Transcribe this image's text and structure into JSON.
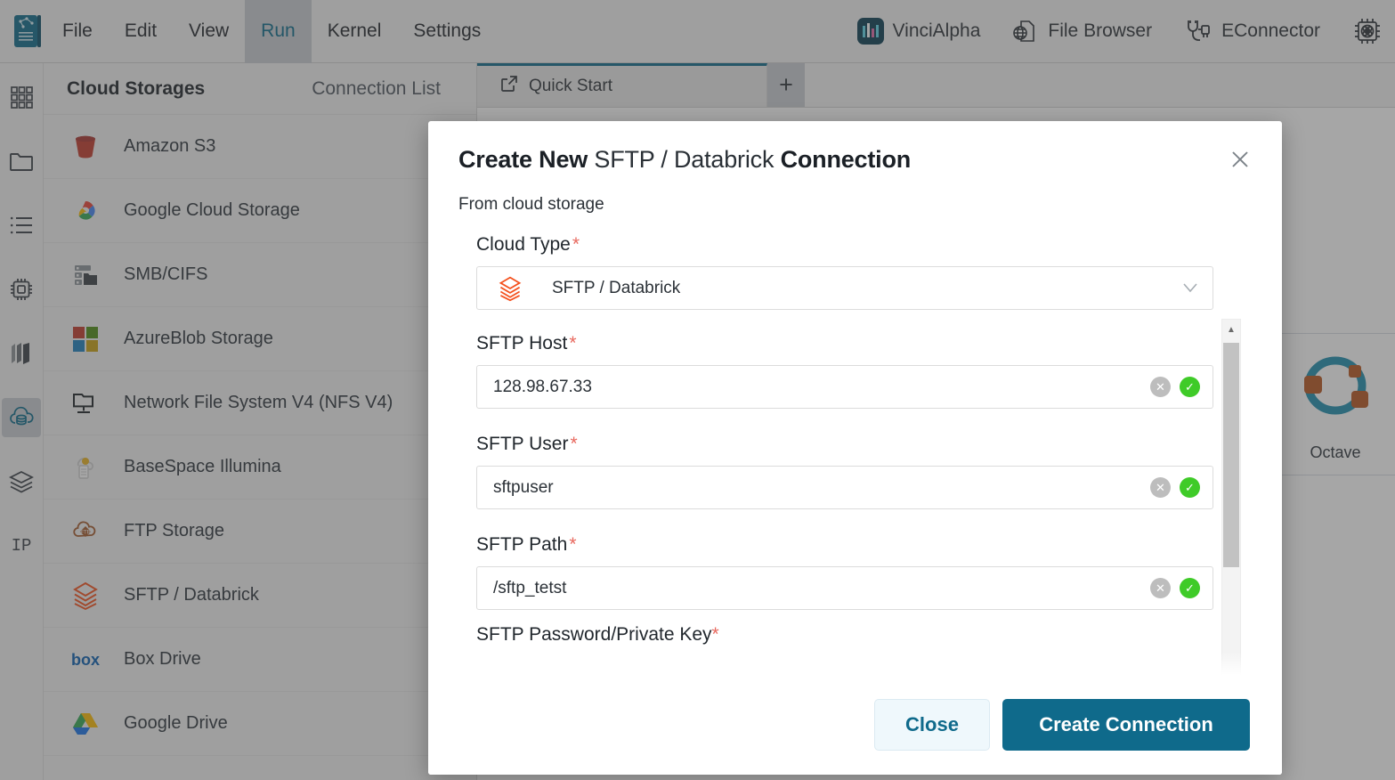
{
  "menubar": {
    "logo_icon": "notebook-logo-icon",
    "items": [
      {
        "label": "File",
        "active": false
      },
      {
        "label": "Edit",
        "active": false
      },
      {
        "label": "View",
        "active": false
      },
      {
        "label": "Run",
        "active": true
      },
      {
        "label": "Kernel",
        "active": false
      },
      {
        "label": "Settings",
        "active": false
      }
    ],
    "tools": [
      {
        "label": "VinciAlpha",
        "icon": "vincialpha-bars-icon"
      },
      {
        "label": "File Browser",
        "icon": "file-browser-globe-icon"
      },
      {
        "label": "EConnector",
        "icon": "econnector-plug-icon"
      }
    ],
    "settings_icon": "atom-chip-icon"
  },
  "activitybar": {
    "items": [
      {
        "icon": "grid-launcher-icon",
        "active": false
      },
      {
        "icon": "folder-icon",
        "active": false
      },
      {
        "icon": "list-icon",
        "active": false
      },
      {
        "icon": "chip-kernel-icon",
        "active": false
      },
      {
        "icon": "layers-stack-icon",
        "active": false
      },
      {
        "icon": "cloud-database-icon",
        "active": true
      },
      {
        "icon": "stacked-layers-icon",
        "active": false
      },
      {
        "icon": "ip-text-icon",
        "active": false,
        "text": "IP"
      }
    ]
  },
  "storage_panel": {
    "tabs": [
      {
        "label": "Cloud Storages",
        "active": true
      },
      {
        "label": "Connection List",
        "active": false
      }
    ],
    "rows": [
      {
        "label": "Amazon S3",
        "icon": "amazon-s3-bucket-icon"
      },
      {
        "label": "Google Cloud Storage",
        "icon": "google-cloud-icon"
      },
      {
        "label": "SMB/CIFS",
        "icon": "smb-cifs-server-icon"
      },
      {
        "label": "AzureBlob Storage",
        "icon": "azure-blob-icon"
      },
      {
        "label": "Network File System V4 (NFS V4)",
        "icon": "nfs-monitor-icon"
      },
      {
        "label": "BaseSpace Illumina",
        "icon": "basespace-illumina-icon"
      },
      {
        "label": "FTP Storage",
        "icon": "ftp-storage-icon"
      },
      {
        "label": "SFTP / Databrick",
        "icon": "sftp-databrick-icon"
      },
      {
        "label": "Box Drive",
        "icon": "box-drive-icon"
      },
      {
        "label": "Google Drive",
        "icon": "google-drive-icon"
      }
    ]
  },
  "doc_area": {
    "tab_label": "Quick Start",
    "tab_icon": "external-link-icon",
    "add_tab_label": "+",
    "launcher_card": {
      "label": "Octave",
      "icon": "octave-logo-icon"
    }
  },
  "modal": {
    "title_part1": "Create New",
    "title_part2": "SFTP / Databrick",
    "title_part3": "Connection",
    "close_icon": "close-icon",
    "subtitle": "From cloud storage",
    "cloud_type": {
      "label": "Cloud Type",
      "required_marker": "*",
      "selected_value": "SFTP / Databrick",
      "option_icon": "sftp-databrick-icon",
      "caret_icon": "chevron-down-icon"
    },
    "fields": [
      {
        "label": "SFTP Host",
        "required_marker": "*",
        "value": "128.98.67.33",
        "placeholder": "SFTP Host",
        "clear_icon": "clear-circle-icon",
        "valid_icon": "valid-check-icon"
      },
      {
        "label": "SFTP User",
        "required_marker": "*",
        "value": "sftpuser",
        "placeholder": "SFTP User",
        "clear_icon": "clear-circle-icon",
        "valid_icon": "valid-check-icon"
      },
      {
        "label": "SFTP Path",
        "required_marker": "*",
        "value": "/sftp_tetst",
        "placeholder": "SFTP Path",
        "clear_icon": "clear-circle-icon",
        "valid_icon": "valid-check-icon"
      }
    ],
    "cutoff_field_label": "SFTP Password/Private Key",
    "cutoff_required_marker": "*",
    "scrollbar": {
      "up_icon": "scroll-up-arrow-icon",
      "down_icon": "scroll-down-arrow-icon"
    },
    "footer": {
      "close_label": "Close",
      "create_label": "Create Connection"
    }
  },
  "colors": {
    "accent": "#0f6a8b",
    "required": "#e8695f",
    "valid": "#3fcb28",
    "sftp_orange": "#f4511e",
    "panel_bg": "#f2f2f2"
  }
}
